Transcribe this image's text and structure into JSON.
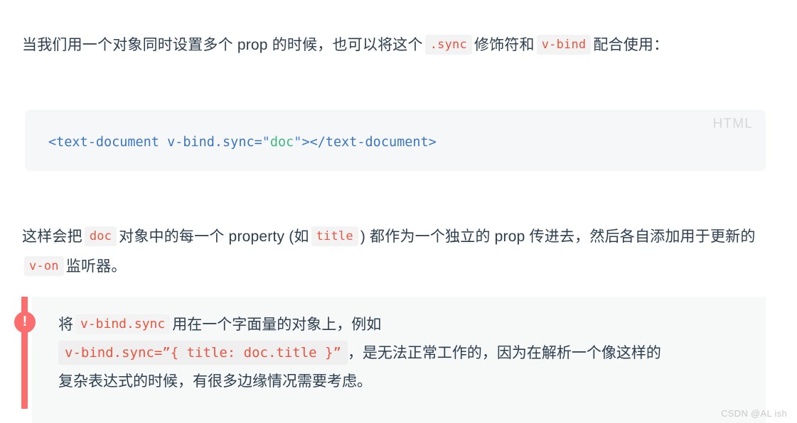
{
  "colors": {
    "body_text": "#2c3e50",
    "inline_code_text": "#e8543f",
    "inline_code_bg": "#f3f3f3",
    "code_block_bg": "#f6f7f8",
    "code_tag": "#3a76c4",
    "code_string": "#42b983",
    "callout_accent": "#fc6d6d",
    "callout_bg": "#f7f8f8",
    "lang_label": "#d7d7dc",
    "watermark": "#c9c9c9",
    "page_bg": "#ffffff"
  },
  "paragraph_1": {
    "segment_1": "当我们用一个对象同时设置多个 prop 的时候，也可以将这个",
    "code_1": ".sync",
    "segment_2": "修饰符和",
    "code_2": "v-bind",
    "segment_3": "配合使用："
  },
  "code_block": {
    "language_label": "HTML",
    "tokens": {
      "open_tag": "<text-document ",
      "attribute": "v-bind.sync=",
      "quote_open": "\"",
      "string_value": "doc",
      "quote_close": "\"",
      "close_bracket": ">",
      "close_tag": "</text-document>"
    },
    "full_text": "<text-document v-bind.sync=\"doc\"></text-document>"
  },
  "paragraph_2": {
    "segment_1": "这样会把",
    "code_1": "doc",
    "segment_2": "对象中的每一个 property (如",
    "code_2": "title",
    "segment_3": ") 都作为一个独立的 prop 传进去，然后各自添加用于更新的",
    "code_3": "v-on",
    "segment_4": "监听器。"
  },
  "callout": {
    "icon": "exclamation-mark",
    "icon_glyph": "!",
    "line_1_before": "将",
    "line_1_code": "v-bind.sync",
    "line_1_after": "用在一个字面量的对象上，例如",
    "line_2_code": "v-bind.sync=”{ title: doc.title }”",
    "line_2_after": "，是无法正常工作的，因为在解析一个像这样的",
    "line_3": "复杂表达式的时候，有很多边缘情况需要考虑。"
  },
  "watermark": {
    "text": "CSDN @AL ish"
  }
}
